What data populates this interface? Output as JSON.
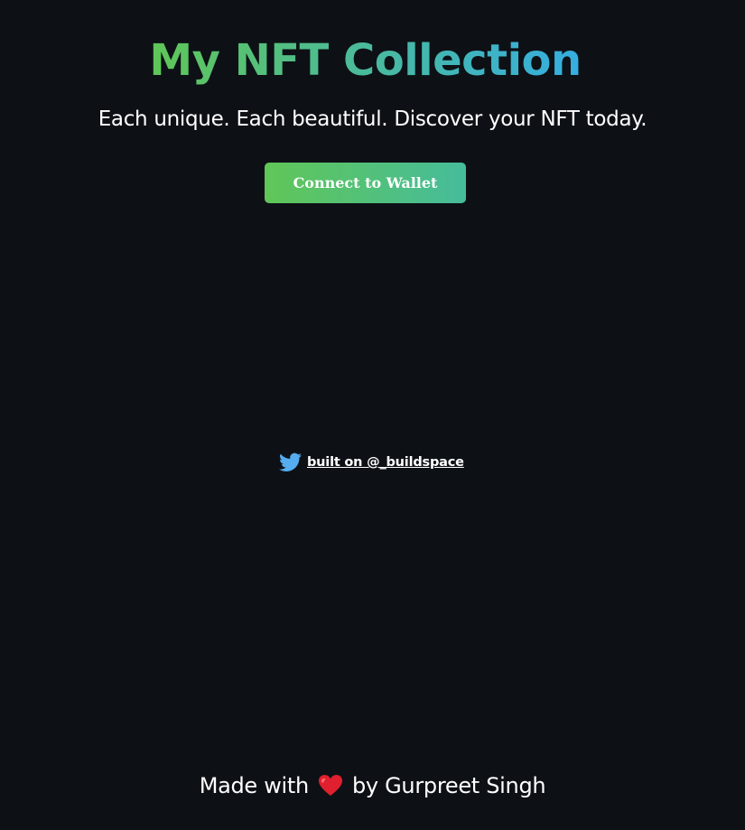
{
  "header": {
    "title": "My NFT Collection",
    "subtitle": "Each unique. Each beautiful. Discover your NFT today."
  },
  "actions": {
    "connect_label": "Connect to Wallet"
  },
  "twitter": {
    "icon": "twitter-bird-icon",
    "link_text": "built on @_buildspace",
    "icon_color": "#55acee"
  },
  "footer": {
    "prefix": "Made with",
    "heart_icon": "heart-icon",
    "suffix": "by Gurpreet Singh"
  },
  "colors": {
    "background": "#0d1116",
    "gradient_start": "#60c657",
    "gradient_end": "#35aee2",
    "button_gradient_end": "#46bc9b",
    "heart": "#e0202e"
  }
}
